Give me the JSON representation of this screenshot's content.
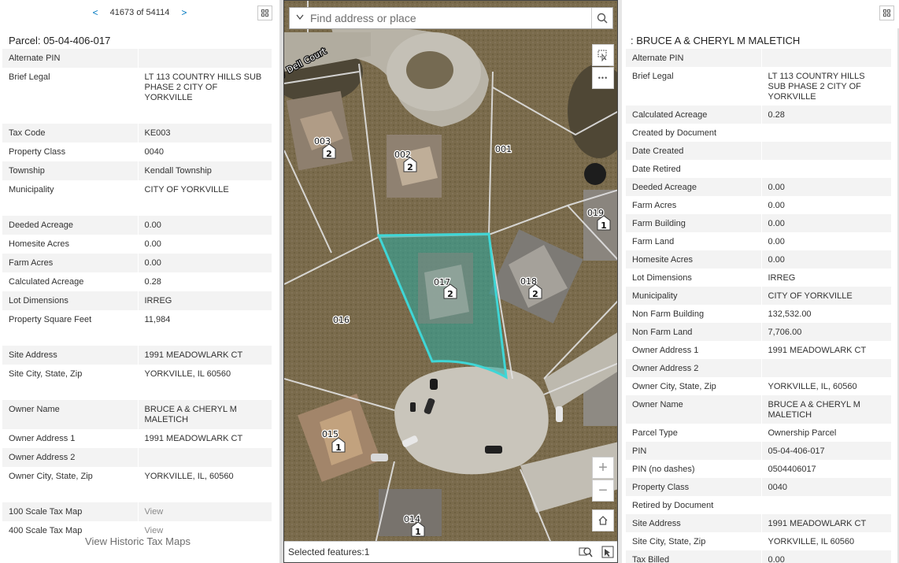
{
  "pager": {
    "prev": "<",
    "text": "41673 of 54114",
    "next": ">"
  },
  "left": {
    "title": "Parcel: 05-04-406-017",
    "rows": [
      {
        "k": "Alternate PIN",
        "v": ""
      },
      {
        "k": "Brief Legal",
        "v": "LT 113 COUNTRY HILLS SUB PHASE 2 CITY OF YORKVILLE"
      },
      {
        "k": "Tax Code",
        "v": "KE003"
      },
      {
        "k": "Property Class",
        "v": "0040"
      },
      {
        "k": "Township",
        "v": "Kendall Township"
      },
      {
        "k": "Municipality",
        "v": "CITY OF YORKVILLE"
      },
      {
        "k": "Deeded Acreage",
        "v": "0.00"
      },
      {
        "k": "Homesite Acres",
        "v": "0.00"
      },
      {
        "k": "Farm Acres",
        "v": "0.00"
      },
      {
        "k": "Calculated Acreage",
        "v": "0.28"
      },
      {
        "k": "Lot Dimensions",
        "v": "IRREG"
      },
      {
        "k": "Property Square Feet",
        "v": "11,984"
      },
      {
        "k": "Site Address",
        "v": "1991 MEADOWLARK CT"
      },
      {
        "k": "Site City, State, Zip",
        "v": "YORKVILLE, IL 60560"
      },
      {
        "k": "Owner Name",
        "v": "BRUCE A & CHERYL M MALETICH"
      },
      {
        "k": "Owner Address 1",
        "v": "1991 MEADOWLARK CT"
      },
      {
        "k": "Owner Address 2",
        "v": ""
      },
      {
        "k": "Owner City, State, Zip",
        "v": "YORKVILLE, IL, 60560"
      },
      {
        "k": "100 Scale Tax Map",
        "v": "View"
      },
      {
        "k": "400 Scale Tax Map",
        "v": "View"
      }
    ],
    "historic_link": "View Historic Tax Maps"
  },
  "map": {
    "search_placeholder": "Find address or place",
    "street_label": "y Dell Court",
    "parcel_labels": [
      "003",
      "002",
      "001",
      "019",
      "017",
      "018",
      "016",
      "015",
      "014"
    ],
    "house_numbers": [
      "2",
      "2",
      "1",
      "2",
      "2",
      "1",
      "1"
    ],
    "zoom_in": "+",
    "zoom_out": "−",
    "more": "•••",
    "selected_text": "Selected features:1",
    "highlight_color": "#3fd6d6"
  },
  "right": {
    "title": ": BRUCE A & CHERYL M MALETICH",
    "rows": [
      {
        "k": "Alternate PIN",
        "v": ""
      },
      {
        "k": "Brief Legal",
        "v": "LT 113 COUNTRY HILLS SUB PHASE 2 CITY OF YORKVILLE"
      },
      {
        "k": "Calculated Acreage",
        "v": "0.28"
      },
      {
        "k": "Created by Document",
        "v": ""
      },
      {
        "k": "Date Created",
        "v": ""
      },
      {
        "k": "Date Retired",
        "v": ""
      },
      {
        "k": "Deeded Acreage",
        "v": "0.00"
      },
      {
        "k": "Farm Acres",
        "v": "0.00"
      },
      {
        "k": "Farm Building",
        "v": "0.00"
      },
      {
        "k": "Farm Land",
        "v": "0.00"
      },
      {
        "k": "Homesite Acres",
        "v": "0.00"
      },
      {
        "k": "Lot Dimensions",
        "v": "IRREG"
      },
      {
        "k": "Municipality",
        "v": "CITY OF YORKVILLE"
      },
      {
        "k": "Non Farm Building",
        "v": "132,532.00"
      },
      {
        "k": "Non Farm Land",
        "v": "7,706.00"
      },
      {
        "k": "Owner Address 1",
        "v": "1991 MEADOWLARK CT"
      },
      {
        "k": "Owner Address 2",
        "v": ""
      },
      {
        "k": "Owner City, State, Zip",
        "v": "YORKVILLE, IL, 60560"
      },
      {
        "k": "Owner Name",
        "v": "BRUCE A & CHERYL M MALETICH"
      },
      {
        "k": "Parcel Type",
        "v": "Ownership Parcel"
      },
      {
        "k": "PIN",
        "v": "05-04-406-017"
      },
      {
        "k": "PIN (no dashes)",
        "v": "0504406017"
      },
      {
        "k": "Property Class",
        "v": "0040"
      },
      {
        "k": "Retired by Document",
        "v": ""
      },
      {
        "k": "Site Address",
        "v": "1991 MEADOWLARK CT"
      },
      {
        "k": "Site City, State, Zip",
        "v": "YORKVILLE, IL 60560"
      },
      {
        "k": "Tax Billed",
        "v": "0.00"
      }
    ]
  }
}
